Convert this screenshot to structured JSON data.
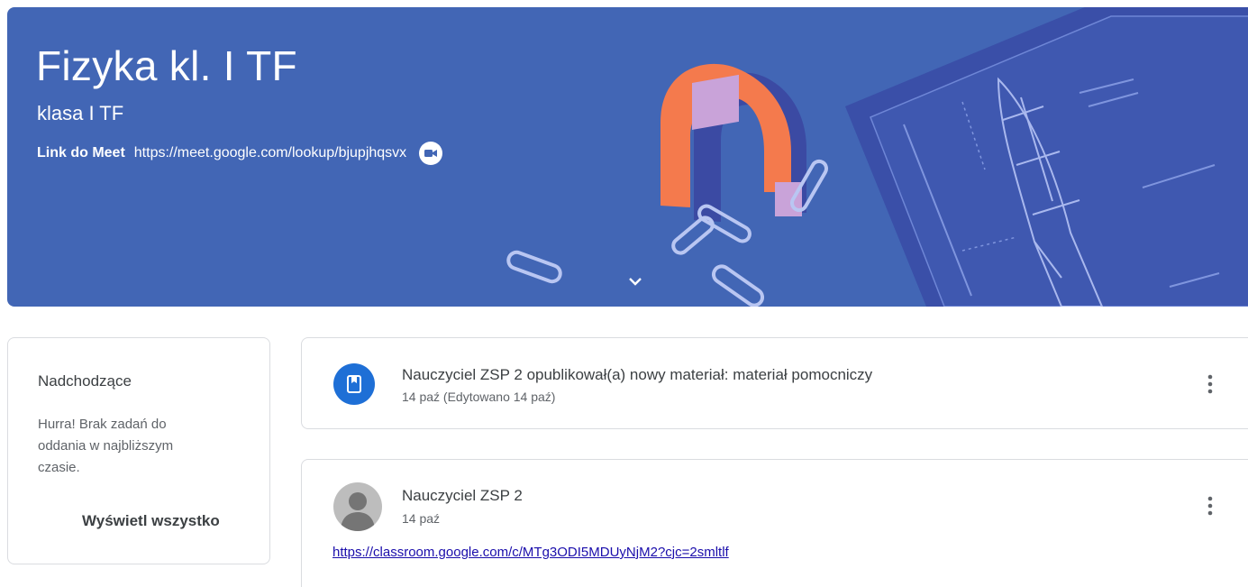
{
  "banner": {
    "title": "Fizyka kl. I TF",
    "subtitle": "klasa I TF",
    "meet_label": "Link do Meet",
    "meet_url": "https://meet.google.com/lookup/bjupjhqsvx",
    "background_color": "#4266b5"
  },
  "upcoming": {
    "title": "Nadchodzące",
    "empty_text": "Hurra! Brak zadań do oddania w najbliższym czasie.",
    "view_all_label": "Wyświetl wszystko"
  },
  "stream": [
    {
      "title": "Nauczyciel ZSP 2 opublikował(a) nowy materiał: materiał pomocniczy",
      "date": "14 paź (Edytowano 14 paź)",
      "icon": "material-icon",
      "icon_color": "#1e6fd6"
    },
    {
      "author": "Nauczyciel ZSP 2",
      "date": "14 paź",
      "link": "https://classroom.google.com/c/MTg3ODI5MDUyNjM2?cjc=2smltlf",
      "icon": "avatar-icon"
    }
  ],
  "colors": {
    "text_primary": "#3c4043",
    "text_secondary": "#5f6368",
    "link": "#1a0dab",
    "border": "#dadce0"
  }
}
